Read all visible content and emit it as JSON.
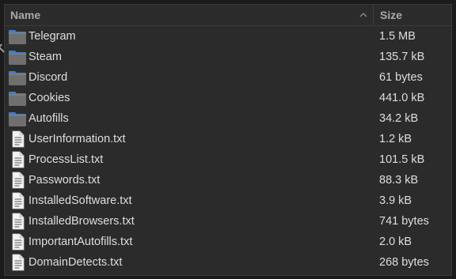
{
  "header": {
    "name_label": "Name",
    "size_label": "Size",
    "sort_icon": "chevron-up-icon"
  },
  "files": [
    {
      "name": "Telegram",
      "size": "1.5 MB",
      "type": "folder",
      "icon": "folder-icon"
    },
    {
      "name": "Steam",
      "size": "135.7 kB",
      "type": "folder",
      "icon": "folder-icon"
    },
    {
      "name": "Discord",
      "size": "61 bytes",
      "type": "folder",
      "icon": "folder-icon"
    },
    {
      "name": "Cookies",
      "size": "441.0 kB",
      "type": "folder",
      "icon": "folder-icon"
    },
    {
      "name": "Autofills",
      "size": "34.2 kB",
      "type": "folder",
      "icon": "folder-icon"
    },
    {
      "name": "UserInformation.txt",
      "size": "1.2 kB",
      "type": "file",
      "icon": "text-file-icon"
    },
    {
      "name": "ProcessList.txt",
      "size": "101.5 kB",
      "type": "file",
      "icon": "text-file-icon"
    },
    {
      "name": "Passwords.txt",
      "size": "88.3 kB",
      "type": "file",
      "icon": "text-file-icon"
    },
    {
      "name": "InstalledSoftware.txt",
      "size": "3.9 kB",
      "type": "file",
      "icon": "text-file-icon"
    },
    {
      "name": "InstalledBrowsers.txt",
      "size": "741 bytes",
      "type": "file",
      "icon": "text-file-icon"
    },
    {
      "name": "ImportantAutofills.txt",
      "size": "2.0 kB",
      "type": "file",
      "icon": "text-file-icon"
    },
    {
      "name": "DomainDetects.txt",
      "size": "268 bytes",
      "type": "file",
      "icon": "text-file-icon"
    }
  ],
  "colors": {
    "background": "#2b2b2b",
    "header_text": "#a9a9a9",
    "row_text": "#dedede",
    "folder_blue": "#3f7fc9",
    "folder_gray": "#6f6f6f"
  }
}
